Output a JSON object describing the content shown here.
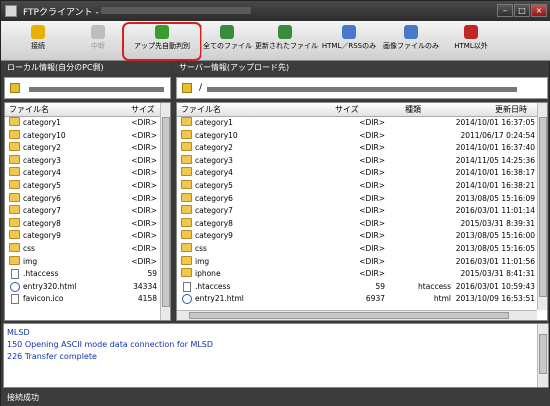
{
  "window": {
    "title": "FTPクライアント -",
    "min": "–",
    "max": "□",
    "close": "×"
  },
  "toolbar": [
    {
      "label": "接続",
      "icon": "connect-icon",
      "color": "#e8b000"
    },
    {
      "label": "中断",
      "icon": "abort-icon",
      "color": "#bdbdbd"
    },
    {
      "label": "アップ先自動判別",
      "icon": "auto-detect-check-icon",
      "color": "#3a9c2c"
    },
    {
      "label": "全てのファイル",
      "icon": "all-files-icon",
      "color": "#3a8c3c"
    },
    {
      "label": "更新されたファイル",
      "icon": "updated-files-icon",
      "color": "#3a8c3c"
    },
    {
      "label": "HTML／RSSのみ",
      "icon": "html-rss-icon",
      "color": "#4a78c8"
    },
    {
      "label": "画像ファイルのみ",
      "icon": "image-files-icon",
      "color": "#4a78c8"
    },
    {
      "label": "HTML以外",
      "icon": "no-html-icon",
      "color": "#c02828"
    }
  ],
  "local": {
    "header": "ローカル情報(自分のPC側)",
    "col_name": "ファイル名",
    "col_size": "サイズ",
    "rows": [
      {
        "name": "category1",
        "size": "<DIR>",
        "type": "folder"
      },
      {
        "name": "category10",
        "size": "<DIR>",
        "type": "folder"
      },
      {
        "name": "category2",
        "size": "<DIR>",
        "type": "folder"
      },
      {
        "name": "category3",
        "size": "<DIR>",
        "type": "folder"
      },
      {
        "name": "category4",
        "size": "<DIR>",
        "type": "folder"
      },
      {
        "name": "category5",
        "size": "<DIR>",
        "type": "folder"
      },
      {
        "name": "category6",
        "size": "<DIR>",
        "type": "folder"
      },
      {
        "name": "category7",
        "size": "<DIR>",
        "type": "folder"
      },
      {
        "name": "category8",
        "size": "<DIR>",
        "type": "folder"
      },
      {
        "name": "category9",
        "size": "<DIR>",
        "type": "folder"
      },
      {
        "name": "css",
        "size": "<DIR>",
        "type": "folder"
      },
      {
        "name": "img",
        "size": "<DIR>",
        "type": "folder"
      },
      {
        "name": ".htaccess",
        "size": "59",
        "type": "file"
      },
      {
        "name": "entry320.html",
        "size": "34334",
        "type": "html"
      },
      {
        "name": "favicon.ico",
        "size": "4158",
        "type": "file"
      }
    ]
  },
  "server": {
    "header": "サーバー情報(アップロード先)",
    "path": "/",
    "col_name": "ファイル名",
    "col_size": "サイズ",
    "col_type": "種類",
    "col_date": "更新日時",
    "rows": [
      {
        "name": "category1",
        "size": "<DIR>",
        "kind": "",
        "date": "2014/10/01 16:37:05",
        "type": "folder"
      },
      {
        "name": "category10",
        "size": "<DIR>",
        "kind": "",
        "date": "2011/06/17 0:24:54",
        "type": "folder"
      },
      {
        "name": "category2",
        "size": "<DIR>",
        "kind": "",
        "date": "2014/10/01 16:37:40",
        "type": "folder"
      },
      {
        "name": "category3",
        "size": "<DIR>",
        "kind": "",
        "date": "2014/11/05 14:25:36",
        "type": "folder"
      },
      {
        "name": "category4",
        "size": "<DIR>",
        "kind": "",
        "date": "2014/10/01 16:38:17",
        "type": "folder"
      },
      {
        "name": "category5",
        "size": "<DIR>",
        "kind": "",
        "date": "2014/10/01 16:38:21",
        "type": "folder"
      },
      {
        "name": "category6",
        "size": "<DIR>",
        "kind": "",
        "date": "2013/08/05 15:16:09",
        "type": "folder"
      },
      {
        "name": "category7",
        "size": "<DIR>",
        "kind": "",
        "date": "2016/03/01 11:01:14",
        "type": "folder"
      },
      {
        "name": "category8",
        "size": "<DIR>",
        "kind": "",
        "date": "2015/03/31 8:39:31",
        "type": "folder"
      },
      {
        "name": "category9",
        "size": "<DIR>",
        "kind": "",
        "date": "2013/08/05 15:16:00",
        "type": "folder"
      },
      {
        "name": "css",
        "size": "<DIR>",
        "kind": "",
        "date": "2013/08/05 15:16:05",
        "type": "folder"
      },
      {
        "name": "img",
        "size": "<DIR>",
        "kind": "",
        "date": "2016/03/01 11:01:56",
        "type": "folder"
      },
      {
        "name": "iphone",
        "size": "<DIR>",
        "kind": "",
        "date": "2015/03/31 8:41:31",
        "type": "folder"
      },
      {
        "name": ".htaccess",
        "size": "59",
        "kind": "htaccess",
        "date": "2016/03/01 10:59:43",
        "type": "file"
      },
      {
        "name": "entry21.html",
        "size": "6937",
        "kind": "html",
        "date": "2013/10/09 16:53:51",
        "type": "html"
      }
    ]
  },
  "log": [
    "MLSD",
    "150 Opening ASCII mode data connection for MLSD",
    "226 Transfer complete"
  ],
  "status": "接続成功"
}
